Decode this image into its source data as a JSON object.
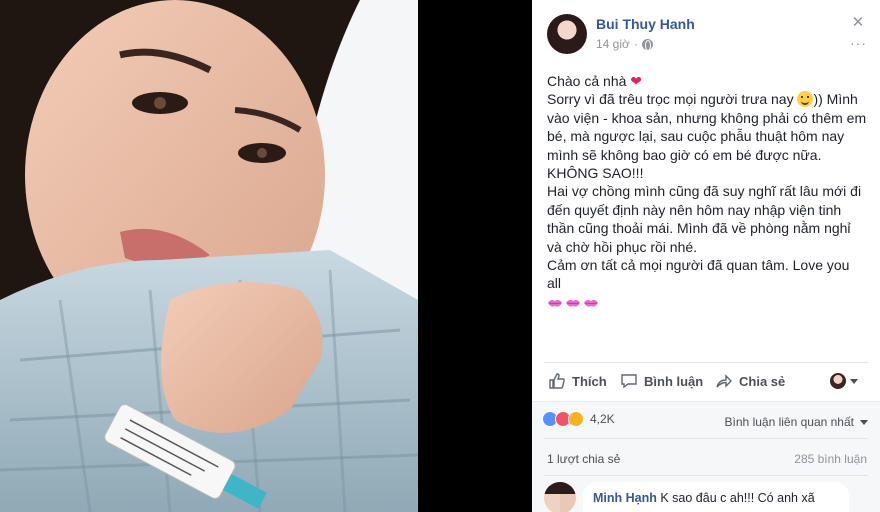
{
  "post": {
    "author": "Bui Thuy Hanh",
    "time": "14 giờ",
    "close_icon": "close-icon",
    "more_icon": "more-options-icon",
    "body": {
      "line1_text": "Chào cả nhà",
      "line2_pre": "Sorry vì đã trêu trọc mọi người trưa nay",
      "line2_post": ")) Mình vào viện - khoa sản, nhưng không phải có thêm em bé, mà ngược lại, sau cuộc phẫu thuật hôm nay mình sẽ không bao giờ có em bé được nữa.",
      "line3": "KHÔNG SAO!!!",
      "line4": "Hai vợ chồng mình cũng đã suy nghĩ rất lâu mới đi đến quyết định này nên hôm nay nhập viện tinh thần cũng thoải mái. Mình đã về phòng nằm nghỉ và chờ hồi phục rồi nhé.",
      "line5": "Cảm ơn tất cả mọi người đã quan tâm. Love you all"
    }
  },
  "actions": {
    "like_label": "Thích",
    "comment_label": "Bình luận",
    "share_label": "Chia sẻ"
  },
  "reactions": {
    "count": "4,2K",
    "sort_label": "Bình luận liên quan nhất",
    "shares": "1 lượt chia sẻ",
    "comments": "285 bình luận"
  },
  "comment": {
    "name": "Minh Hạnh",
    "text": "K sao đâu c ah!!! Có anh xã"
  },
  "colors": {
    "link_blue": "#365899",
    "meta_gray": "#90949c",
    "like_blue": "#5890ff",
    "love_red": "#f25268",
    "sad_yellow": "#f7b125"
  }
}
